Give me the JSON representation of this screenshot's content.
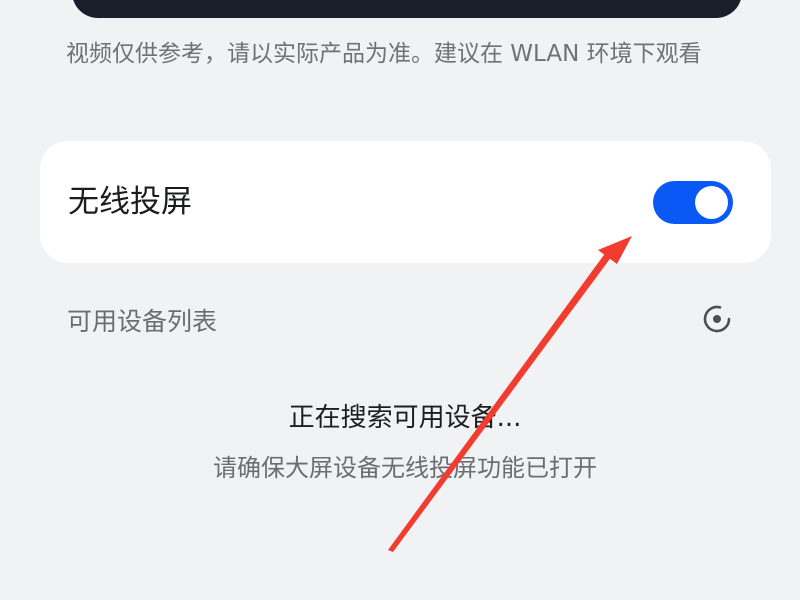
{
  "video": {
    "note": "视频仅供参考，请以实际产品为准。建议在 WLAN 环境下观看"
  },
  "wireless_projection": {
    "label": "无线投屏",
    "enabled": true
  },
  "devices": {
    "section_title": "可用设备列表",
    "refresh_icon": "refresh-icon",
    "status_main": "正在搜索可用设备...",
    "status_sub": "请确保大屏设备无线投屏功能已打开"
  },
  "colors": {
    "toggle_on": "#0a59f7",
    "annotation_arrow": "#f23c30"
  }
}
